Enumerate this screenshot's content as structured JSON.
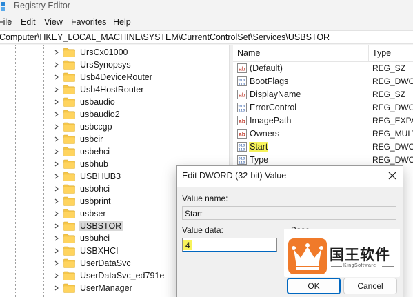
{
  "window": {
    "title": "Registry Editor"
  },
  "menu": [
    "File",
    "Edit",
    "View",
    "Favorites",
    "Help"
  ],
  "address": "Computer\\HKEY_LOCAL_MACHINE\\SYSTEM\\CurrentControlSet\\Services\\USBSTOR",
  "tree": {
    "items": [
      {
        "label": "UrsCx01000",
        "selected": false
      },
      {
        "label": "UrsSynopsys",
        "selected": false
      },
      {
        "label": "Usb4DeviceRouter",
        "selected": false
      },
      {
        "label": "Usb4HostRouter",
        "selected": false
      },
      {
        "label": "usbaudio",
        "selected": false
      },
      {
        "label": "usbaudio2",
        "selected": false
      },
      {
        "label": "usbccgp",
        "selected": false
      },
      {
        "label": "usbcir",
        "selected": false
      },
      {
        "label": "usbehci",
        "selected": false
      },
      {
        "label": "usbhub",
        "selected": false
      },
      {
        "label": "USBHUB3",
        "selected": false
      },
      {
        "label": "usbohci",
        "selected": false
      },
      {
        "label": "usbprint",
        "selected": false
      },
      {
        "label": "usbser",
        "selected": false
      },
      {
        "label": "USBSTOR",
        "selected": true
      },
      {
        "label": "usbuhci",
        "selected": false
      },
      {
        "label": "USBXHCI",
        "selected": false
      },
      {
        "label": "UserDataSvc",
        "selected": false
      },
      {
        "label": "UserDataSvc_ed791e",
        "selected": false
      },
      {
        "label": "UserManager",
        "selected": false
      }
    ]
  },
  "values_pane": {
    "columns": {
      "name": "Name",
      "type": "Type"
    },
    "rows": [
      {
        "name": "(Default)",
        "type": "REG_SZ",
        "icon": "string-value-icon",
        "highlight": false
      },
      {
        "name": "BootFlags",
        "type": "REG_DWOR",
        "icon": "binary-value-icon",
        "highlight": false
      },
      {
        "name": "DisplayName",
        "type": "REG_SZ",
        "icon": "string-value-icon",
        "highlight": false
      },
      {
        "name": "ErrorControl",
        "type": "REG_DWOR",
        "icon": "binary-value-icon",
        "highlight": false
      },
      {
        "name": "ImagePath",
        "type": "REG_EXPAN",
        "icon": "string-value-icon",
        "highlight": false
      },
      {
        "name": "Owners",
        "type": "REG_MULTI",
        "icon": "string-value-icon",
        "highlight": false
      },
      {
        "name": "Start",
        "type": "REG_DWOR",
        "icon": "binary-value-icon",
        "highlight": true
      },
      {
        "name": "Type",
        "type": "REG_DWOR",
        "icon": "binary-value-icon",
        "highlight": false
      }
    ]
  },
  "dialog": {
    "title": "Edit DWORD (32-bit) Value",
    "value_name_label": "Value name:",
    "value_name": "Start",
    "value_data_label": "Value data:",
    "value_data": "4",
    "base_label": "Base",
    "ok_label": "OK",
    "cancel_label": "Cancel"
  },
  "watermark": {
    "name": "国王软件",
    "sub": "KingSoftware"
  },
  "colors": {
    "accent": "#0067c0",
    "highlight": "#f7f35a",
    "folder": "#f5c648",
    "logo_orange": "#f07a2a"
  }
}
